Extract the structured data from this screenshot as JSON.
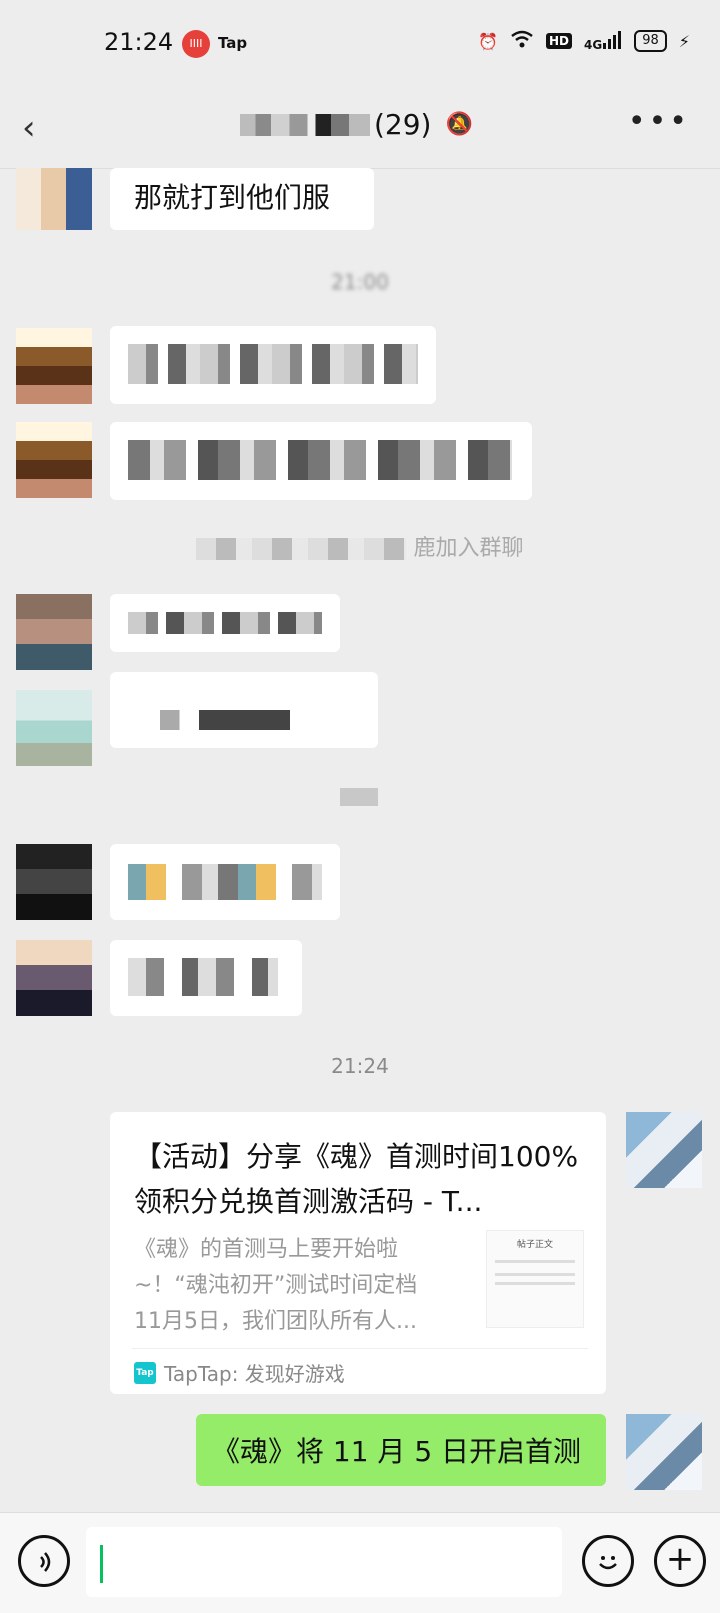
{
  "status_bar": {
    "time": "21:24",
    "app_logo_text": "IIII",
    "tap_label": "Tap",
    "signal_label": "4G",
    "hd_label": "HD",
    "battery": "98"
  },
  "header": {
    "member_count": "(29)",
    "icons": [
      "back-arrow",
      "mute-bell",
      "more-dots"
    ]
  },
  "messages": {
    "first_text": "那就打到他们服",
    "time1": "21:00",
    "join_notice": "鹿加入群聊",
    "time2": "21:24",
    "partial_text": "我"
  },
  "link_card": {
    "title": "【活动】分享《魂》首测时间100%领积分兑换首测激活码 - T...",
    "desc": "《魂》的首测马上要开始啦~！“魂沌初开”测试时间定档11月5日，我们团队所有人...",
    "source_icon": "Tap",
    "source": "TapTap: 发现好游戏",
    "thumb_heading": "帖子正文"
  },
  "my_message": "《魂》将 11 月 5 日开启首测",
  "input_bar": {
    "icons": [
      "voice-icon",
      "emoji-icon",
      "plus-icon"
    ]
  }
}
